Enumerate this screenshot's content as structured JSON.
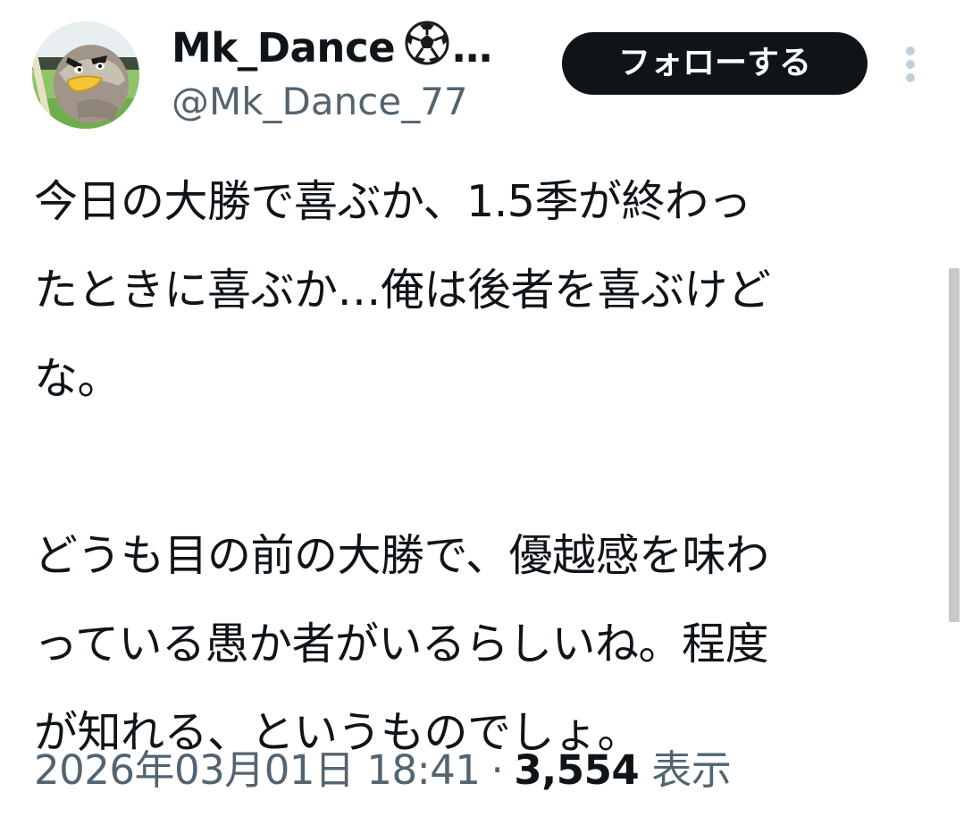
{
  "user": {
    "display_name": "Mk_Dance",
    "name_icon": "soccer-ball-icon",
    "name_ellipsis": "…",
    "handle": "@Mk_Dance_77",
    "avatar_icon": "farfetchd-avatar"
  },
  "actions": {
    "follow_label": "フォローする",
    "more_icon": "vertical-ellipsis-icon"
  },
  "tweet": {
    "lines": [
      "今日の大勝で喜ぶか、1.5季が終わっ",
      "たときに喜ぶか…俺は後者を喜ぶけど",
      "な。",
      "",
      "どうも目の前の大勝で、優越感を味わ",
      "っている愚か者がいるらしいね。程度",
      "が知れる、というものでしょ。"
    ]
  },
  "meta": {
    "date": "2026年03月01日",
    "time": "18:41",
    "separator": "·",
    "views": "3,554",
    "views_label": "表示"
  },
  "colors": {
    "text": "#0f1419",
    "secondary": "#536471",
    "button_bg": "#0f1419",
    "button_text": "#ffffff"
  }
}
